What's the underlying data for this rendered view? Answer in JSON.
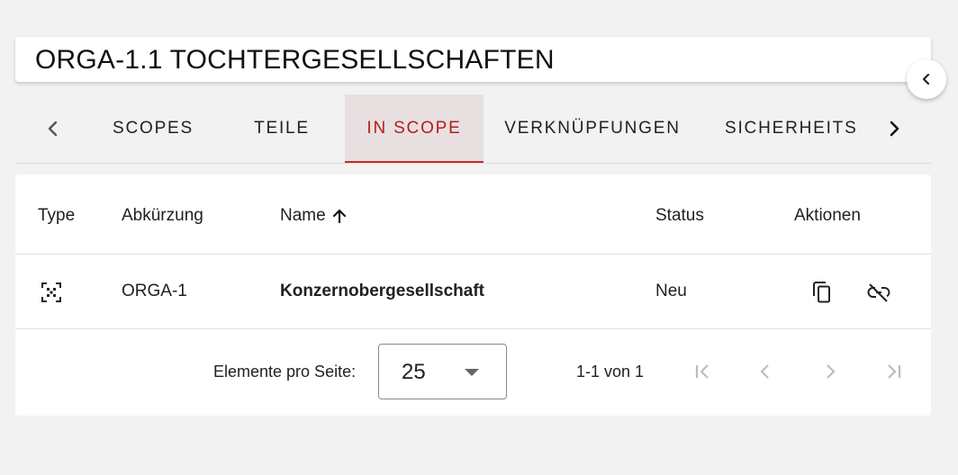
{
  "header": {
    "title": "ORGA-1.1 TOCHTERGESELLSCHAFTEN"
  },
  "tabs": [
    {
      "label": "SCOPES"
    },
    {
      "label": "TEILE"
    },
    {
      "label": "IN SCOPE",
      "active": true
    },
    {
      "label": "VERKNÜPFUNGEN"
    },
    {
      "label": "SICHERHEITSMASSNAHMEN"
    }
  ],
  "table": {
    "headers": {
      "type": "Type",
      "abbreviation": "Abkürzung",
      "name": "Name",
      "status": "Status",
      "actions": "Aktionen"
    },
    "sort": {
      "column": "name",
      "direction": "ascending",
      "icon": "arrow-up-icon"
    },
    "rows": [
      {
        "type_icon": "scope-icon",
        "abbreviation": "ORGA-1",
        "name": "Konzernobergesellschaft",
        "status": "Neu",
        "actions": [
          "copy-icon",
          "unlink-icon"
        ]
      }
    ]
  },
  "paginator": {
    "items_per_page_label": "Elemente pro Seite:",
    "page_size": "25",
    "range": "1-1 von 1",
    "buttons": [
      "first-page-icon",
      "previous-page-icon",
      "next-page-icon",
      "last-page-icon"
    ]
  },
  "colors": {
    "accent": "#c62828",
    "active_tab_bg": "#e8e0e0",
    "background": "#f2f2f2"
  }
}
